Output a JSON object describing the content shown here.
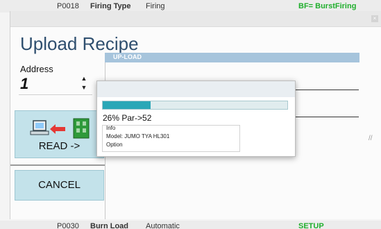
{
  "background": {
    "top_row": {
      "col1": "P0018",
      "col2": "Firing Type",
      "col3": "Firing",
      "col4": "BF= BurstFiring"
    },
    "bottom_row": {
      "col1": "P0030",
      "col2": "Burn Load",
      "col3": "Automatic",
      "col4": "SETUP"
    }
  },
  "dialog": {
    "title": "Upload Recipe",
    "close_icon": "×",
    "address": {
      "label": "Address",
      "value": "1"
    },
    "read_button": {
      "label": "READ ->"
    },
    "cancel_button": {
      "label": "CANCEL"
    },
    "upload_panel": {
      "header": "UP-LOAD"
    }
  },
  "progress_popup": {
    "progress": 0.26,
    "status_text": "26% Par->52",
    "info_title": "Info",
    "info_lines": [
      "Model: JUMO TYA HL301",
      "Option"
    ]
  },
  "colors": {
    "accent": "#2aa7b7",
    "button_bg": "#c3e2ea",
    "header_bar": "#a6c4dc",
    "title_text": "#2f4f6f",
    "arrow_red": "#e53935",
    "device_green": "#2e9a3a"
  },
  "icons": [
    "computer-icon",
    "red-arrow-left-icon",
    "device-module-icon",
    "spin-up-icon",
    "spin-down-icon",
    "close-icon",
    "resize-grip-icon"
  ]
}
